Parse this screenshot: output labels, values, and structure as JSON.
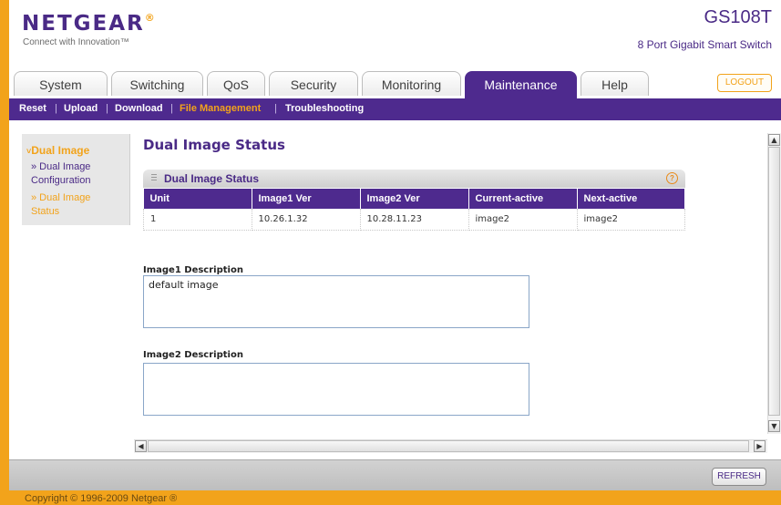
{
  "brand": {
    "logo": "NETGEAR",
    "registered": "®",
    "tagline": "Connect with Innovation™"
  },
  "device": {
    "model": "GS108T",
    "subtitle": "8 Port Gigabit Smart Switch"
  },
  "tabs": [
    {
      "label": "System"
    },
    {
      "label": "Switching"
    },
    {
      "label": "QoS"
    },
    {
      "label": "Security"
    },
    {
      "label": "Monitoring"
    },
    {
      "label": "Maintenance",
      "active": true
    },
    {
      "label": "Help"
    }
  ],
  "logout_label": "LOGOUT",
  "subnav": [
    {
      "label": "Reset"
    },
    {
      "label": "Upload"
    },
    {
      "label": "Download"
    },
    {
      "label": "File Management",
      "active": true
    },
    {
      "label": "Troubleshooting"
    }
  ],
  "sidebar": {
    "heading": "Dual Image",
    "items": [
      {
        "label_line1": "» Dual Image",
        "label_line2": "Configuration"
      },
      {
        "label_line1": "» Dual Image",
        "label_line2": "Status",
        "active": true
      }
    ]
  },
  "page_title": "Dual Image Status",
  "panel": {
    "title": "Dual Image Status",
    "help_icon": "?",
    "columns": [
      "Unit",
      "Image1 Ver",
      "Image2 Ver",
      "Current-active",
      "Next-active"
    ],
    "rows": [
      [
        "1",
        "10.26.1.32",
        "10.28.11.23",
        "image2",
        "image2"
      ]
    ]
  },
  "image1_description": {
    "label": "Image1 Description",
    "value": "default image"
  },
  "image2_description": {
    "label": "Image2 Description",
    "value": ""
  },
  "refresh_label": "REFRESH",
  "copyright": "Copyright © 1996-2009 Netgear ®",
  "colors": {
    "purple": "#4e2a8e",
    "orange": "#f2a31b"
  }
}
